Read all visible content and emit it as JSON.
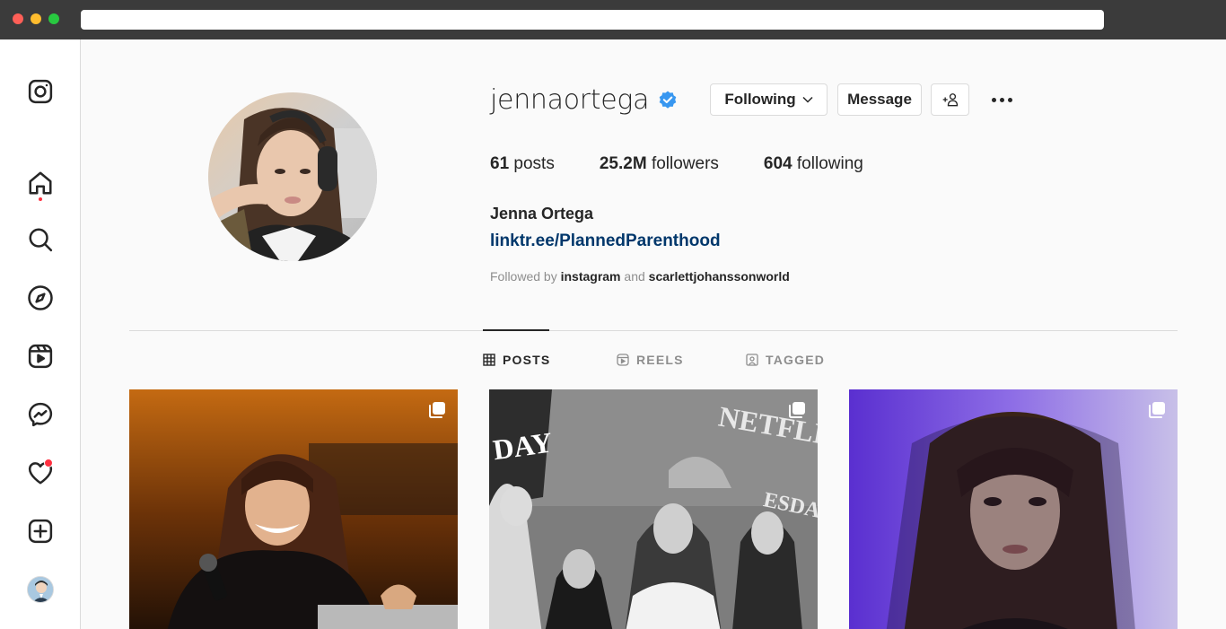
{
  "colors": {
    "chrome": "#3b3b3b",
    "dot_red": "#fe5f57",
    "dot_yellow": "#febc2e",
    "dot_green": "#28c840",
    "notification": "#ff3040",
    "verified": "#3897f0",
    "link": "#00376b",
    "muted": "#8e8e8e",
    "text": "#262626"
  },
  "sidebar": {
    "items": [
      {
        "name": "instagram-logo-icon"
      },
      {
        "name": "home-icon"
      },
      {
        "name": "search-icon"
      },
      {
        "name": "explore-compass-icon"
      },
      {
        "name": "reels-icon"
      },
      {
        "name": "messenger-icon"
      },
      {
        "name": "heart-notifications-icon"
      },
      {
        "name": "create-plus-icon"
      },
      {
        "name": "profile-avatar"
      }
    ]
  },
  "profile": {
    "username": "jennaortega",
    "verified": true,
    "actions": {
      "following_label": "Following",
      "message_label": "Message",
      "suggest_label": "+👤"
    },
    "stats": {
      "posts_count": "61",
      "posts_label": "posts",
      "followers_count": "25.2M",
      "followers_label": "followers",
      "following_count": "604",
      "following_label": "following"
    },
    "full_name": "Jenna Ortega",
    "link": "linktr.ee/PlannedParenthood",
    "followed_by": {
      "prefix": "Followed by",
      "account1": "instagram",
      "conjunction": "and",
      "account2": "scarlettjohanssonworld"
    }
  },
  "tabs": [
    {
      "label": "POSTS",
      "active": true
    },
    {
      "label": "REELS",
      "active": false
    },
    {
      "label": "TAGGED",
      "active": false
    }
  ],
  "posts": [
    {
      "type": "carousel",
      "icon": "multiple-photos-icon"
    },
    {
      "type": "carousel",
      "icon": "multiple-photos-icon",
      "caption_text": [
        "NETFLIX",
        "DAY",
        "ESDAY"
      ]
    },
    {
      "type": "carousel",
      "icon": "multiple-photos-icon"
    }
  ]
}
